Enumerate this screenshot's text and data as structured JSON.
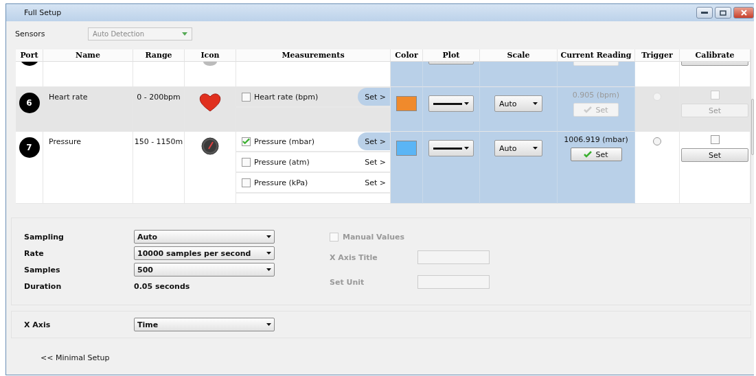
{
  "window": {
    "title": "Full Setup"
  },
  "sensors": {
    "label": "Sensors",
    "value": "Auto Detection"
  },
  "table": {
    "columns": [
      "Port",
      "Name",
      "Range",
      "Icon",
      "Measurements",
      "Color",
      "Plot",
      "Scale",
      "Current Reading",
      "Trigger",
      "Calibrate"
    ],
    "rows": [
      {
        "kind": "cut"
      },
      {
        "kind": "heart",
        "port": "6",
        "name": "Heart rate",
        "range": "0 - 200bpm",
        "highlighted": true,
        "measurements": [
          {
            "label": "Heart rate (bpm)",
            "checked": false,
            "action": "Set >",
            "selected": true
          }
        ],
        "color": "#f08a2c",
        "scale": "Auto",
        "reading": "0.905 (bpm)",
        "reading_enabled": false,
        "set": "Set",
        "trigger_disabled": true,
        "calibrate_checked": false,
        "calibrate": "Set",
        "calibrate_enabled": false
      },
      {
        "kind": "gauge",
        "port": "7",
        "name": "Pressure",
        "range": "150 - 1150m",
        "highlighted": false,
        "measurements": [
          {
            "label": "Pressure (mbar)",
            "checked": true,
            "action": "Set >",
            "selected": true
          },
          {
            "label": "Pressure (atm)",
            "checked": false,
            "action": "Set >",
            "selected": false
          },
          {
            "label": "Pressure (kPa)",
            "checked": false,
            "action": "Set >",
            "selected": false
          }
        ],
        "color": "#5bb5f5",
        "scale": "Auto",
        "reading": "1006.919 (mbar)",
        "reading_enabled": true,
        "set": "Set",
        "trigger_disabled": false,
        "calibrate_checked": false,
        "calibrate": "Set",
        "calibrate_enabled": true
      }
    ]
  },
  "sampling": [
    {
      "kind": "select",
      "label": "Sampling",
      "value": "Auto"
    },
    {
      "kind": "select",
      "label": "Rate",
      "value": "10000 samples per second"
    },
    {
      "kind": "select",
      "label": "Samples",
      "value": "500"
    },
    {
      "kind": "text",
      "label": "Duration",
      "value": "0.05 seconds"
    }
  ],
  "manual": {
    "label": "Manual Values",
    "checked": false,
    "disabled": true,
    "fields": [
      {
        "label": "X Axis Title"
      },
      {
        "label": "Set Unit"
      }
    ]
  },
  "x_axis": {
    "label": "X Axis",
    "value": "Time"
  },
  "link": "<< Minimal Setup"
}
